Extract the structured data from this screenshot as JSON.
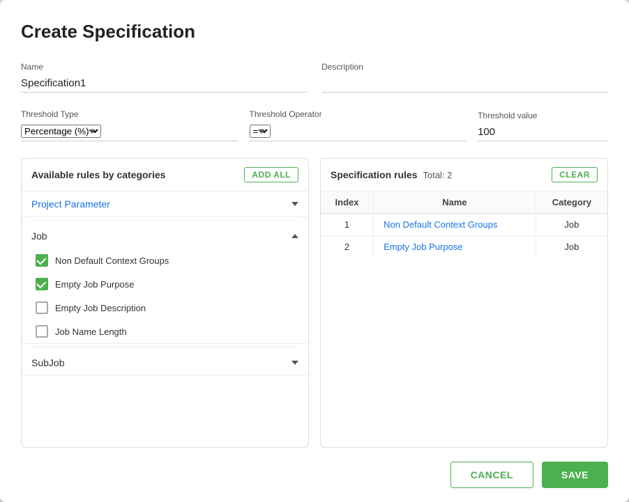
{
  "modal": {
    "title": "Create Specification"
  },
  "form": {
    "name_label": "Name",
    "name_value": "Specification1",
    "description_label": "Description",
    "description_value": "",
    "threshold_type_label": "Threshold Type",
    "threshold_type_value": "Percentage (%)",
    "threshold_operator_label": "Threshold Operator",
    "threshold_operator_value": "=",
    "threshold_value_label": "Threshold value",
    "threshold_value": "100"
  },
  "left_panel": {
    "title": "Available rules by categories",
    "add_all_label": "ADD ALL",
    "category_dropdown_label": "Project Parameter",
    "categories": [
      {
        "name": "Job",
        "expanded": true,
        "rules": [
          {
            "label": "Non Default Context Groups",
            "checked": true
          },
          {
            "label": "Empty Job Purpose",
            "checked": true
          },
          {
            "label": "Empty Job Description",
            "checked": false
          },
          {
            "label": "Job Name Length",
            "checked": false
          }
        ]
      },
      {
        "name": "SubJob",
        "expanded": false,
        "rules": []
      }
    ]
  },
  "right_panel": {
    "title": "Specification rules",
    "total_label": "Total: 2",
    "clear_label": "CLEAR",
    "columns": [
      "Index",
      "Name",
      "Category"
    ],
    "rows": [
      {
        "index": "1",
        "name": "Non Default Context Groups",
        "category": "Job"
      },
      {
        "index": "2",
        "name": "Empty Job Purpose",
        "category": "Job"
      }
    ]
  },
  "footer": {
    "cancel_label": "CANCEL",
    "save_label": "SAVE"
  }
}
